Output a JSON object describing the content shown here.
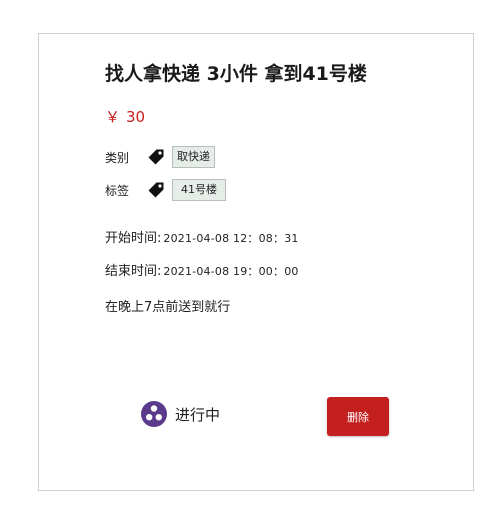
{
  "task": {
    "title": "找人拿快递 3小件 拿到41号楼",
    "currency_symbol": "￥",
    "price": "30",
    "category_label": "类别",
    "category_value": "取快递",
    "tag_label": "标签",
    "tag_value": "41号楼",
    "start_label": "开始时间:",
    "start_value": "2021-04-08  12：08：31",
    "end_label": "结束时间:",
    "end_value": "2021-04-08  19：00：00",
    "description": "在晚上7点前送到就行"
  },
  "status": {
    "text": "进行中",
    "icon": "in-progress-dots-icon",
    "color": "#5b3a8c"
  },
  "actions": {
    "delete_label": "删除",
    "delete_color": "#c41f1f"
  },
  "colors": {
    "price": "#c8201a",
    "tag_bg": "#e6ece8",
    "border": "#cfcfcf"
  }
}
